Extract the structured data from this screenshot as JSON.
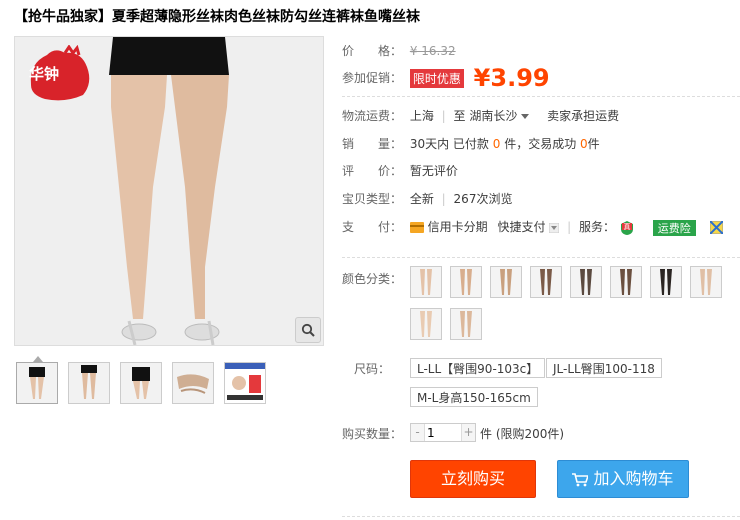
{
  "title": "【抢牛品独家】夏季超薄隐形丝袜肉色丝袜防勾丝连裤袜鱼嘴丝袜",
  "brand_logo_text": "华钟",
  "price": {
    "label": "价　　格：",
    "original": "¥ 16.32"
  },
  "promo": {
    "label": "参加促销：",
    "badge": "限时优惠",
    "currency": "¥",
    "price": "3.99"
  },
  "shipping": {
    "label": "物流运费：",
    "from": "上海",
    "to_label": "至",
    "to": "湖南长沙",
    "fee": "卖家承担运费"
  },
  "sales": {
    "label": "销　　量：",
    "prefix": "30天内 已付款 ",
    "paid": "0",
    "mid": " 件，交易成功 ",
    "done": "0",
    "suffix": "件"
  },
  "review": {
    "label": "评　　价：",
    "value": "暂无评价"
  },
  "item_type": {
    "label": "宝贝类型：",
    "value": "全新",
    "views": "267次浏览"
  },
  "payment": {
    "label": "支　　付：",
    "credit": "信用卡分期",
    "quick": "快捷支付",
    "service_label": "服务：",
    "service_badge_zhen": "真",
    "service_badge_freight": "运费险"
  },
  "color": {
    "label": "颜色分类："
  },
  "size": {
    "label": "尺码：",
    "options": [
      "L-LL【臀围90-103c】",
      "JL-LL臀围100-118",
      "M-L身高150-165cm"
    ]
  },
  "qty": {
    "label": "购买数量：",
    "minus": "-",
    "plus": "+",
    "value": "1",
    "stock": "件 (限购200件)"
  },
  "buttons": {
    "buy": "立刻购买",
    "cart": "加入购物车"
  },
  "colors": {
    "accent": "#ff4400",
    "cart_blue": "#3da6ec",
    "badge_green": "#2aa44a"
  }
}
